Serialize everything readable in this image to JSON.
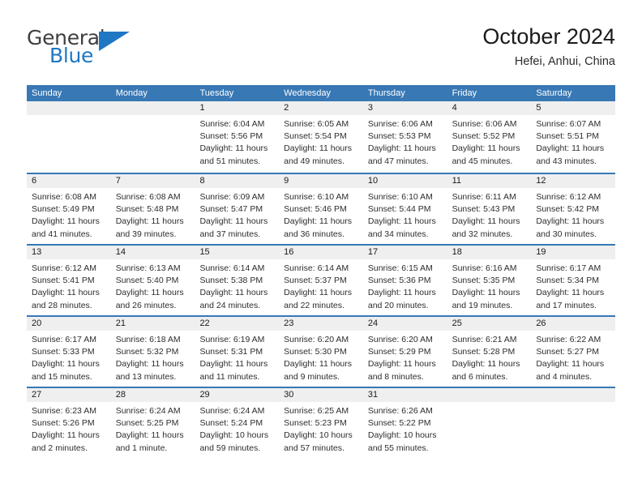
{
  "brand": {
    "word_one": "General",
    "word_two": "Blue",
    "logo_icon": "blue-triangle-icon"
  },
  "header": {
    "title": "October 2024",
    "subtitle": "Hefei, Anhui, China"
  },
  "theme": {
    "header_blue": "#3878b5",
    "day_band_gray": "#efefef",
    "brand_blue": "#1f77c4",
    "text_dark": "#2d2d2d"
  },
  "weekdays": [
    "Sunday",
    "Monday",
    "Tuesday",
    "Wednesday",
    "Thursday",
    "Friday",
    "Saturday"
  ],
  "weeks": [
    [
      {
        "day": "",
        "lines": []
      },
      {
        "day": "",
        "lines": []
      },
      {
        "day": "1",
        "lines": [
          "Sunrise: 6:04 AM",
          "Sunset: 5:56 PM",
          "Daylight: 11 hours",
          "and 51 minutes."
        ]
      },
      {
        "day": "2",
        "lines": [
          "Sunrise: 6:05 AM",
          "Sunset: 5:54 PM",
          "Daylight: 11 hours",
          "and 49 minutes."
        ]
      },
      {
        "day": "3",
        "lines": [
          "Sunrise: 6:06 AM",
          "Sunset: 5:53 PM",
          "Daylight: 11 hours",
          "and 47 minutes."
        ]
      },
      {
        "day": "4",
        "lines": [
          "Sunrise: 6:06 AM",
          "Sunset: 5:52 PM",
          "Daylight: 11 hours",
          "and 45 minutes."
        ]
      },
      {
        "day": "5",
        "lines": [
          "Sunrise: 6:07 AM",
          "Sunset: 5:51 PM",
          "Daylight: 11 hours",
          "and 43 minutes."
        ]
      }
    ],
    [
      {
        "day": "6",
        "lines": [
          "Sunrise: 6:08 AM",
          "Sunset: 5:49 PM",
          "Daylight: 11 hours",
          "and 41 minutes."
        ]
      },
      {
        "day": "7",
        "lines": [
          "Sunrise: 6:08 AM",
          "Sunset: 5:48 PM",
          "Daylight: 11 hours",
          "and 39 minutes."
        ]
      },
      {
        "day": "8",
        "lines": [
          "Sunrise: 6:09 AM",
          "Sunset: 5:47 PM",
          "Daylight: 11 hours",
          "and 37 minutes."
        ]
      },
      {
        "day": "9",
        "lines": [
          "Sunrise: 6:10 AM",
          "Sunset: 5:46 PM",
          "Daylight: 11 hours",
          "and 36 minutes."
        ]
      },
      {
        "day": "10",
        "lines": [
          "Sunrise: 6:10 AM",
          "Sunset: 5:44 PM",
          "Daylight: 11 hours",
          "and 34 minutes."
        ]
      },
      {
        "day": "11",
        "lines": [
          "Sunrise: 6:11 AM",
          "Sunset: 5:43 PM",
          "Daylight: 11 hours",
          "and 32 minutes."
        ]
      },
      {
        "day": "12",
        "lines": [
          "Sunrise: 6:12 AM",
          "Sunset: 5:42 PM",
          "Daylight: 11 hours",
          "and 30 minutes."
        ]
      }
    ],
    [
      {
        "day": "13",
        "lines": [
          "Sunrise: 6:12 AM",
          "Sunset: 5:41 PM",
          "Daylight: 11 hours",
          "and 28 minutes."
        ]
      },
      {
        "day": "14",
        "lines": [
          "Sunrise: 6:13 AM",
          "Sunset: 5:40 PM",
          "Daylight: 11 hours",
          "and 26 minutes."
        ]
      },
      {
        "day": "15",
        "lines": [
          "Sunrise: 6:14 AM",
          "Sunset: 5:38 PM",
          "Daylight: 11 hours",
          "and 24 minutes."
        ]
      },
      {
        "day": "16",
        "lines": [
          "Sunrise: 6:14 AM",
          "Sunset: 5:37 PM",
          "Daylight: 11 hours",
          "and 22 minutes."
        ]
      },
      {
        "day": "17",
        "lines": [
          "Sunrise: 6:15 AM",
          "Sunset: 5:36 PM",
          "Daylight: 11 hours",
          "and 20 minutes."
        ]
      },
      {
        "day": "18",
        "lines": [
          "Sunrise: 6:16 AM",
          "Sunset: 5:35 PM",
          "Daylight: 11 hours",
          "and 19 minutes."
        ]
      },
      {
        "day": "19",
        "lines": [
          "Sunrise: 6:17 AM",
          "Sunset: 5:34 PM",
          "Daylight: 11 hours",
          "and 17 minutes."
        ]
      }
    ],
    [
      {
        "day": "20",
        "lines": [
          "Sunrise: 6:17 AM",
          "Sunset: 5:33 PM",
          "Daylight: 11 hours",
          "and 15 minutes."
        ]
      },
      {
        "day": "21",
        "lines": [
          "Sunrise: 6:18 AM",
          "Sunset: 5:32 PM",
          "Daylight: 11 hours",
          "and 13 minutes."
        ]
      },
      {
        "day": "22",
        "lines": [
          "Sunrise: 6:19 AM",
          "Sunset: 5:31 PM",
          "Daylight: 11 hours",
          "and 11 minutes."
        ]
      },
      {
        "day": "23",
        "lines": [
          "Sunrise: 6:20 AM",
          "Sunset: 5:30 PM",
          "Daylight: 11 hours",
          "and 9 minutes."
        ]
      },
      {
        "day": "24",
        "lines": [
          "Sunrise: 6:20 AM",
          "Sunset: 5:29 PM",
          "Daylight: 11 hours",
          "and 8 minutes."
        ]
      },
      {
        "day": "25",
        "lines": [
          "Sunrise: 6:21 AM",
          "Sunset: 5:28 PM",
          "Daylight: 11 hours",
          "and 6 minutes."
        ]
      },
      {
        "day": "26",
        "lines": [
          "Sunrise: 6:22 AM",
          "Sunset: 5:27 PM",
          "Daylight: 11 hours",
          "and 4 minutes."
        ]
      }
    ],
    [
      {
        "day": "27",
        "lines": [
          "Sunrise: 6:23 AM",
          "Sunset: 5:26 PM",
          "Daylight: 11 hours",
          "and 2 minutes."
        ]
      },
      {
        "day": "28",
        "lines": [
          "Sunrise: 6:24 AM",
          "Sunset: 5:25 PM",
          "Daylight: 11 hours",
          "and 1 minute."
        ]
      },
      {
        "day": "29",
        "lines": [
          "Sunrise: 6:24 AM",
          "Sunset: 5:24 PM",
          "Daylight: 10 hours",
          "and 59 minutes."
        ]
      },
      {
        "day": "30",
        "lines": [
          "Sunrise: 6:25 AM",
          "Sunset: 5:23 PM",
          "Daylight: 10 hours",
          "and 57 minutes."
        ]
      },
      {
        "day": "31",
        "lines": [
          "Sunrise: 6:26 AM",
          "Sunset: 5:22 PM",
          "Daylight: 10 hours",
          "and 55 minutes."
        ]
      },
      {
        "day": "",
        "lines": []
      },
      {
        "day": "",
        "lines": []
      }
    ]
  ]
}
